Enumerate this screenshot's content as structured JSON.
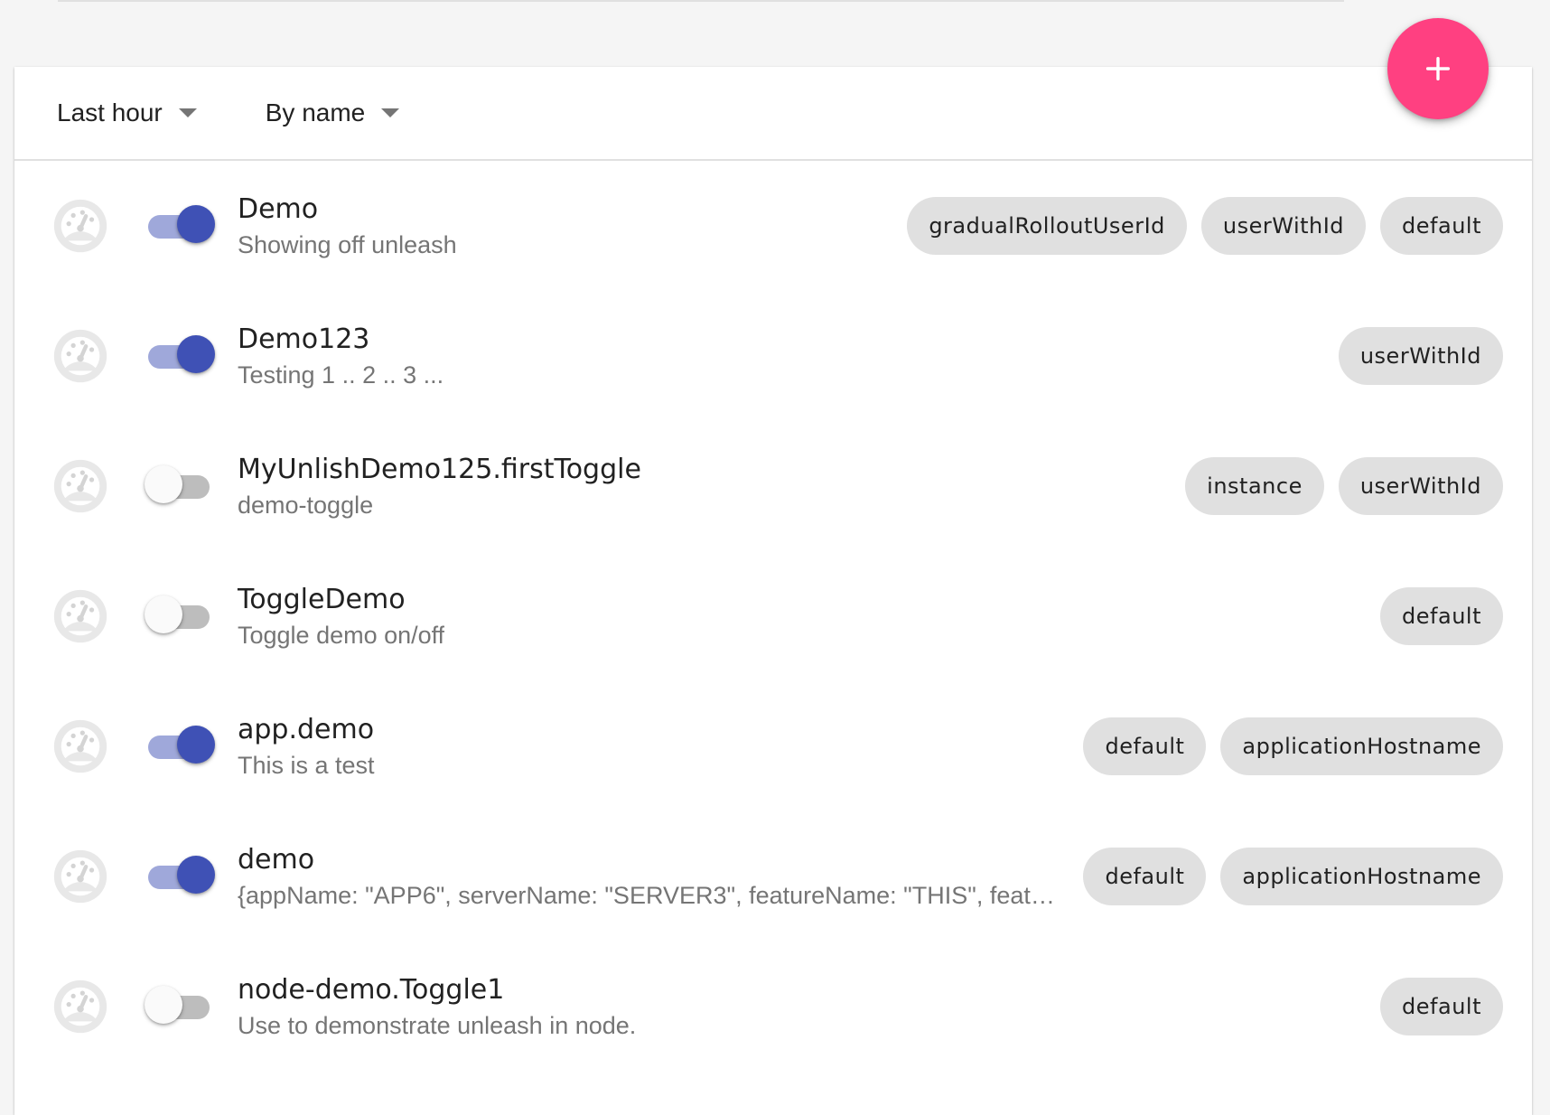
{
  "toolbar": {
    "time_filter": "Last hour",
    "sort_filter": "By name"
  },
  "fab": {
    "icon": "plus-icon",
    "color": "#ff4081"
  },
  "colors": {
    "switch_on": "#3f51b5",
    "switch_on_track": "#9fa8da",
    "chip_bg": "#e0e0e0"
  },
  "features": [
    {
      "name": "Demo",
      "description": "Showing off unleash",
      "enabled": true,
      "strategies": [
        "gradualRolloutUserId",
        "userWithId",
        "default"
      ]
    },
    {
      "name": "Demo123",
      "description": "Testing 1 .. 2 .. 3 ...",
      "enabled": true,
      "strategies": [
        "userWithId"
      ]
    },
    {
      "name": "MyUnlishDemo125.firstToggle",
      "description": "demo-toggle",
      "enabled": false,
      "strategies": [
        "instance",
        "userWithId"
      ]
    },
    {
      "name": "ToggleDemo",
      "description": "Toggle demo on/off",
      "enabled": false,
      "strategies": [
        "default"
      ]
    },
    {
      "name": "app.demo",
      "description": "This is a test",
      "enabled": true,
      "strategies": [
        "default",
        "applicationHostname"
      ]
    },
    {
      "name": "demo",
      "description": "{appName: \"APP6\", serverName: \"SERVER3\", featureName: \"THIS\", featu…",
      "enabled": true,
      "strategies": [
        "default",
        "applicationHostname"
      ]
    },
    {
      "name": "node-demo.Toggle1",
      "description": "Use to demonstrate unleash in node.",
      "enabled": false,
      "strategies": [
        "default"
      ]
    }
  ]
}
